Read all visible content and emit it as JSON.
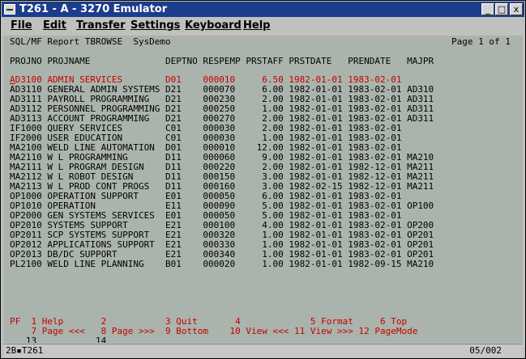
{
  "window": {
    "title": "T261 - A - 3270 Emulator",
    "minimize_glyph": "_",
    "maximize_glyph": "□",
    "close_glyph": "x"
  },
  "menu": [
    {
      "label": "File"
    },
    {
      "label": "Edit"
    },
    {
      "label": "Transfer"
    },
    {
      "label": "Settings"
    },
    {
      "label": "Keyboard"
    },
    {
      "label": "Help"
    }
  ],
  "screen": {
    "header_left": "SQL/MF Report TBROWSE  SysDemo",
    "header_right": "Page 1 of 1",
    "column_header": "PROJNO PROJNAME              DEPTNO RESPEMP PRSTAFF PRSTDATE   PRENDATE   MAJPR",
    "first_row_cursor": "A",
    "first_row_rest": "D3100 ADMIN SERVICES        D01    000010     6.50 1982-01-01 1983-02-01",
    "rows": [
      "AD3110 GENERAL ADMIN SYSTEMS D21    000070     6.00 1982-01-01 1983-02-01 AD310",
      "AD3111 PAYROLL PROGRAMMING   D21    000230     2.00 1982-01-01 1983-02-01 AD311",
      "AD3112 PERSONNEL PROGRAMMING D21    000250     1.00 1982-01-01 1983-02-01 AD311",
      "AD3113 ACCOUNT PROGRAMMING   D21    000270     2.00 1982-01-01 1983-02-01 AD311",
      "IF1000 QUERY SERVICES        C01    000030     2.00 1982-01-01 1983-02-01",
      "IF2000 USER EDUCATION        C01    000030     1.00 1982-01-01 1983-02-01",
      "MA2100 WELD LINE AUTOMATION  D01    000010    12.00 1982-01-01 1983-02-01",
      "MA2110 W L PROGRAMMING       D11    000060     9.00 1982-01-01 1983-02-01 MA210",
      "MA2111 W L PROGRAM DESIGN    D11    000220     2.00 1982-01-01 1982-12-01 MA211",
      "MA2112 W L ROBOT DESIGN      D11    000150     3.00 1982-01-01 1982-12-01 MA211",
      "MA2113 W L PROD CONT PROGS   D11    000160     3.00 1982-02-15 1982-12-01 MA211",
      "OP1000 OPERATION SUPPORT     E01    000050     6.00 1982-01-01 1983-02-01",
      "OP1010 OPERATION             E11    000090     5.00 1982-01-01 1983-02-01 OP100",
      "OP2000 GEN SYSTEMS SERVICES  E01    000050     5.00 1982-01-01 1983-02-01",
      "OP2010 SYSTEMS SUPPORT       E21    000100     4.00 1982-01-01 1983-02-01 OP200",
      "OP2011 SCP SYSTEMS SUPPORT   E21    000320     1.00 1982-01-01 1983-02-01 OP201",
      "OP2012 APPLICATIONS SUPPORT  E21    000330     1.00 1982-01-01 1983-02-01 OP201",
      "OP2013 DB/DC SUPPORT         E21    000340     1.00 1982-01-01 1983-02-01 OP201",
      "PL2100 WELD LINE PLANNING    B01    000020     1.00 1982-01-01 1982-09-15 MA210"
    ],
    "pf_line1": "PF  1 Help       2           3 Quit       4             5 Format     6 Top",
    "pf_line2": "    7 Page <<<   8 Page >>>  9 Bottom    10 View <<< 11 View >>> 12 PageMode",
    "pf_line3": "   13           14"
  },
  "status": {
    "left": "2B▪T261",
    "right": "05/002"
  }
}
